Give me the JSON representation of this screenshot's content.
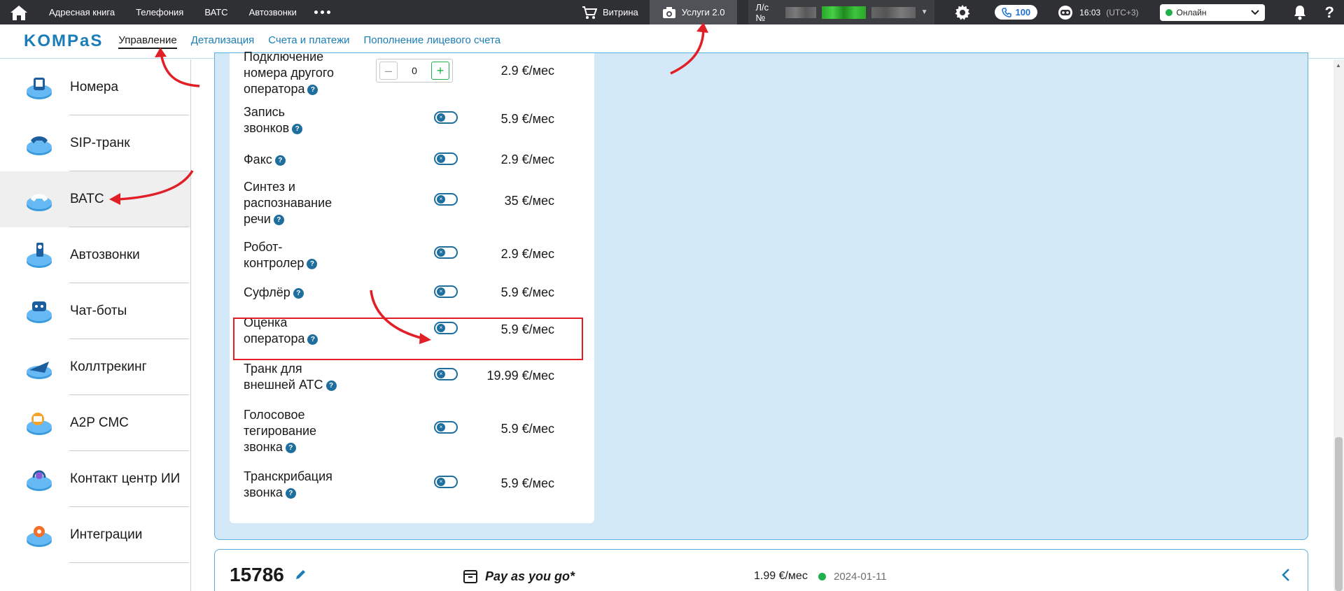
{
  "topbar": {
    "nav": [
      "Адресная книга",
      "Телефония",
      "ВАТС",
      "Автозвонки"
    ],
    "shop_label": "Витрина",
    "services_label": "Услуги 2.0",
    "account_label": "Л/с №",
    "calls_count": "100",
    "time": "16:03",
    "timezone": "(UTC+3)",
    "status": "Онлайн",
    "help": "?"
  },
  "subbar": {
    "logo": "KOMPaS",
    "tabs": [
      "Управление",
      "Детализация",
      "Счета и платежи",
      "Пополнение лицевого счета"
    ],
    "active_tab": "Управление"
  },
  "sidebar": {
    "items": [
      {
        "label": "Номера",
        "icon": "numbers-icon"
      },
      {
        "label": "SIP-транк",
        "icon": "sip-trunk-icon"
      },
      {
        "label": "ВАТС",
        "icon": "vats-icon"
      },
      {
        "label": "Автозвонки",
        "icon": "autocalls-icon"
      },
      {
        "label": "Чат-боты",
        "icon": "chatbots-icon"
      },
      {
        "label": "Коллтрекинг",
        "icon": "calltracking-icon"
      },
      {
        "label": "A2P СМС",
        "icon": "a2p-sms-icon"
      },
      {
        "label": "Контакт центр ИИ",
        "icon": "ai-contact-center-icon"
      },
      {
        "label": "Интеграции",
        "icon": "integrations-icon"
      }
    ],
    "active": "ВАТС"
  },
  "services": {
    "first_row": {
      "lines": [
        "Подключение",
        "номера другого",
        "оператора"
      ],
      "quantity": "0",
      "price": "2.9 €/мес"
    },
    "rows": [
      {
        "lines": [
          "Запись",
          "звонков"
        ],
        "price": "5.9 €/мес"
      },
      {
        "lines": [
          "Факс"
        ],
        "price": "2.9 €/мес"
      },
      {
        "lines": [
          "Синтез и",
          "распознавание",
          "речи"
        ],
        "price": "35 €/мес"
      },
      {
        "lines": [
          "Робот-",
          "контролер"
        ],
        "price": "2.9 €/мес"
      },
      {
        "lines": [
          "Суфлёр"
        ],
        "price": "5.9 €/мес"
      },
      {
        "lines": [
          "Оценка",
          "оператора"
        ],
        "price": "5.9 €/мес"
      },
      {
        "lines": [
          "Транк для",
          "внешней АТС"
        ],
        "price": "19.99 €/мес"
      },
      {
        "lines": [
          "Голосовое",
          "тегирование",
          "звонка"
        ],
        "price": "5.9 €/мес"
      },
      {
        "lines": [
          "Транскрибация",
          "звонка"
        ],
        "price": "5.9 €/мес"
      }
    ],
    "help_mark": "?",
    "toggle_mark": "×"
  },
  "bottom": {
    "number": "15786",
    "plan": "Pay as you go*",
    "cost": "1.99 €/мес",
    "date": "2024-01-11"
  },
  "colors": {
    "topbar": "#2f3033",
    "accent": "#1b7db8",
    "panel": "#d4e9f7",
    "toggle": "#1e6e9e",
    "highlight": "#e21e26",
    "online": "#1fb04b"
  }
}
